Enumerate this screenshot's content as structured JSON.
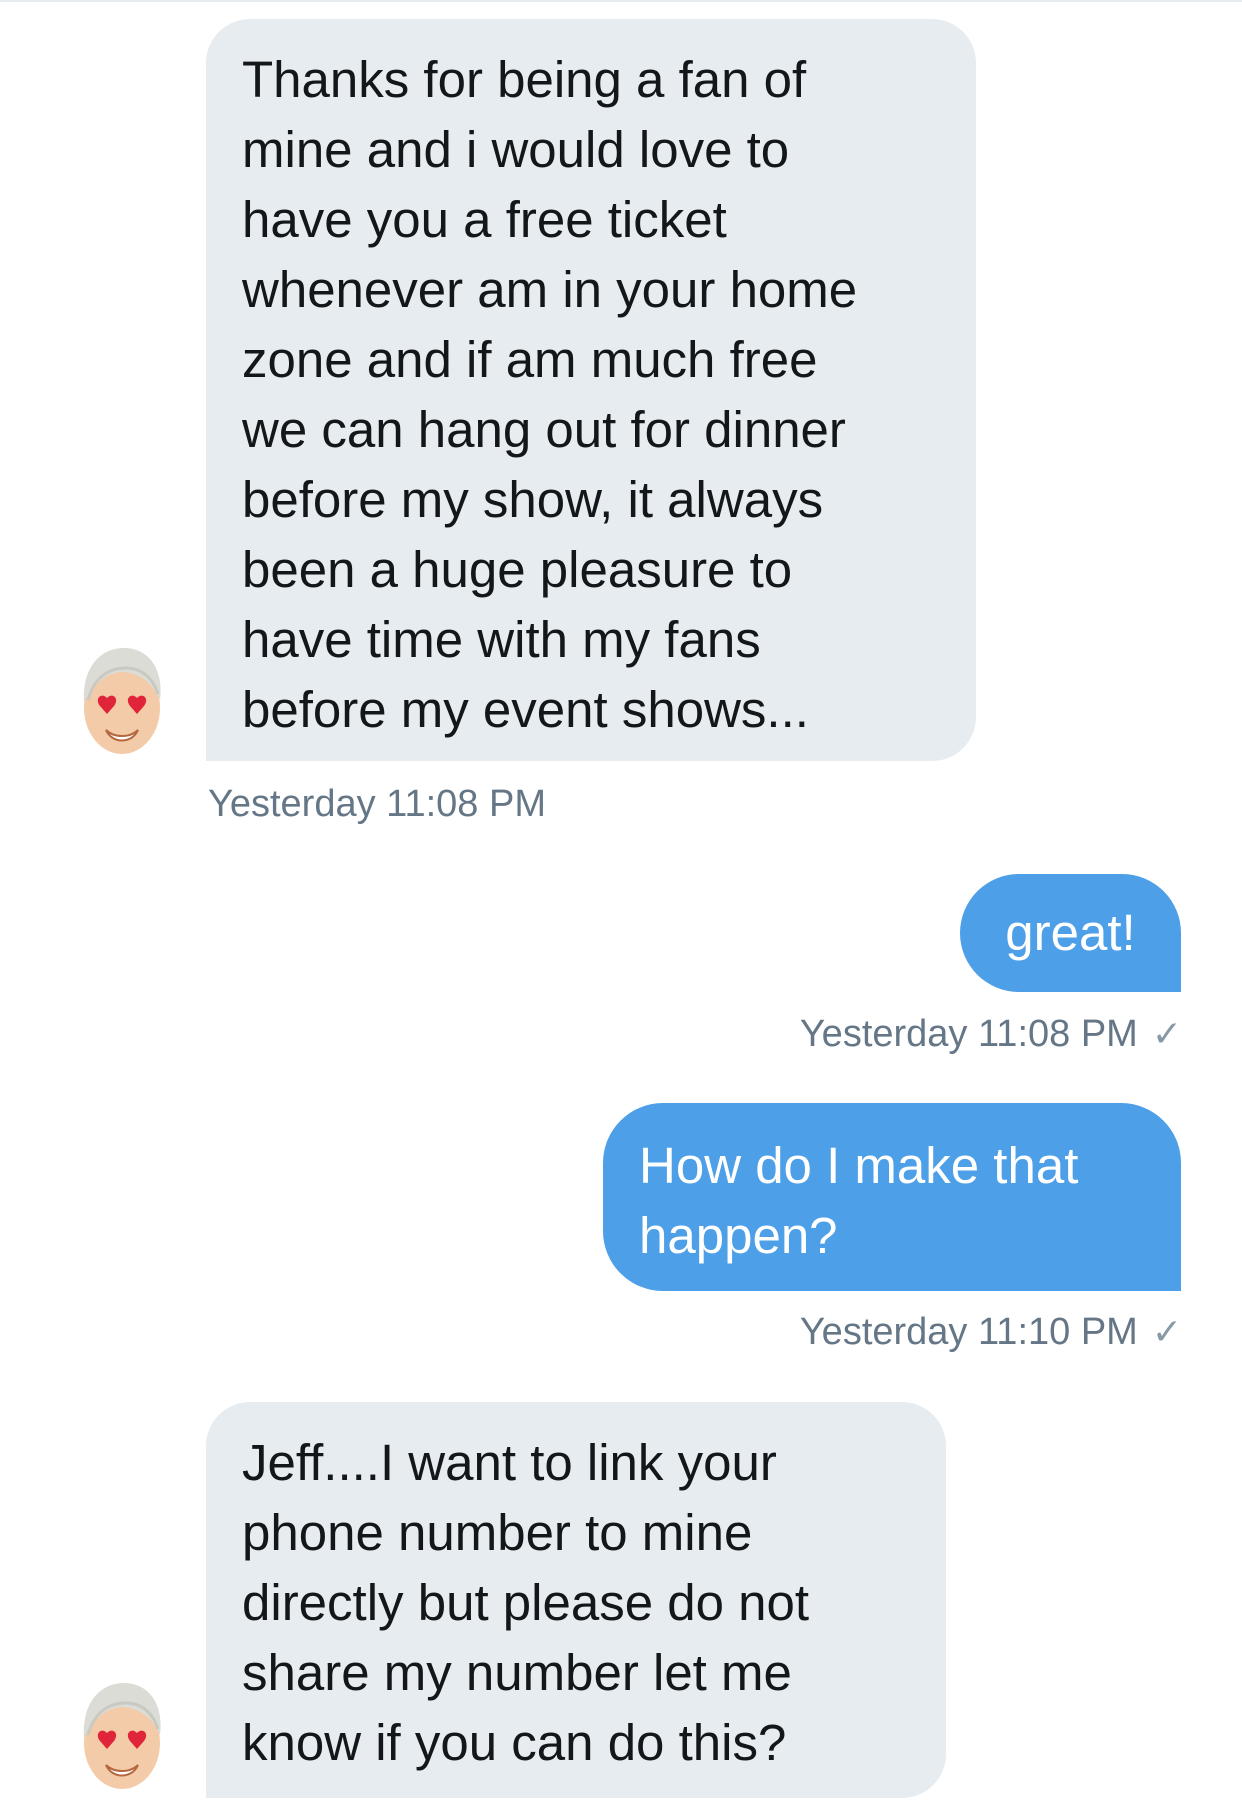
{
  "messages": [
    {
      "side": "incoming",
      "text": "Thanks for being a fan of\nmine and i would love to\nhave you a free ticket\nwhenever am in your home\nzone and if am much free\nwe can hang out for dinner\nbefore my show, it always\nbeen a huge pleasure to\nhave time with my fans\nbefore my event shows...",
      "timestamp": "Yesterday 11:08 PM"
    },
    {
      "side": "outgoing",
      "text": "great!",
      "timestamp": "Yesterday 11:08 PM",
      "status_icon": "checkmark-icon"
    },
    {
      "side": "outgoing",
      "text": "How do I make that\nhappen?",
      "timestamp": "Yesterday 11:10 PM",
      "status_icon": "checkmark-icon"
    },
    {
      "side": "incoming",
      "text": "Jeff....I want to link your\nphone number to mine\ndirectly but please do not\nshare my number let me\nknow if you can do this?"
    }
  ],
  "colors": {
    "incoming_bubble": "#e6ecf0",
    "outgoing_bubble": "#4d9fe8",
    "timestamp_text": "#657786"
  }
}
